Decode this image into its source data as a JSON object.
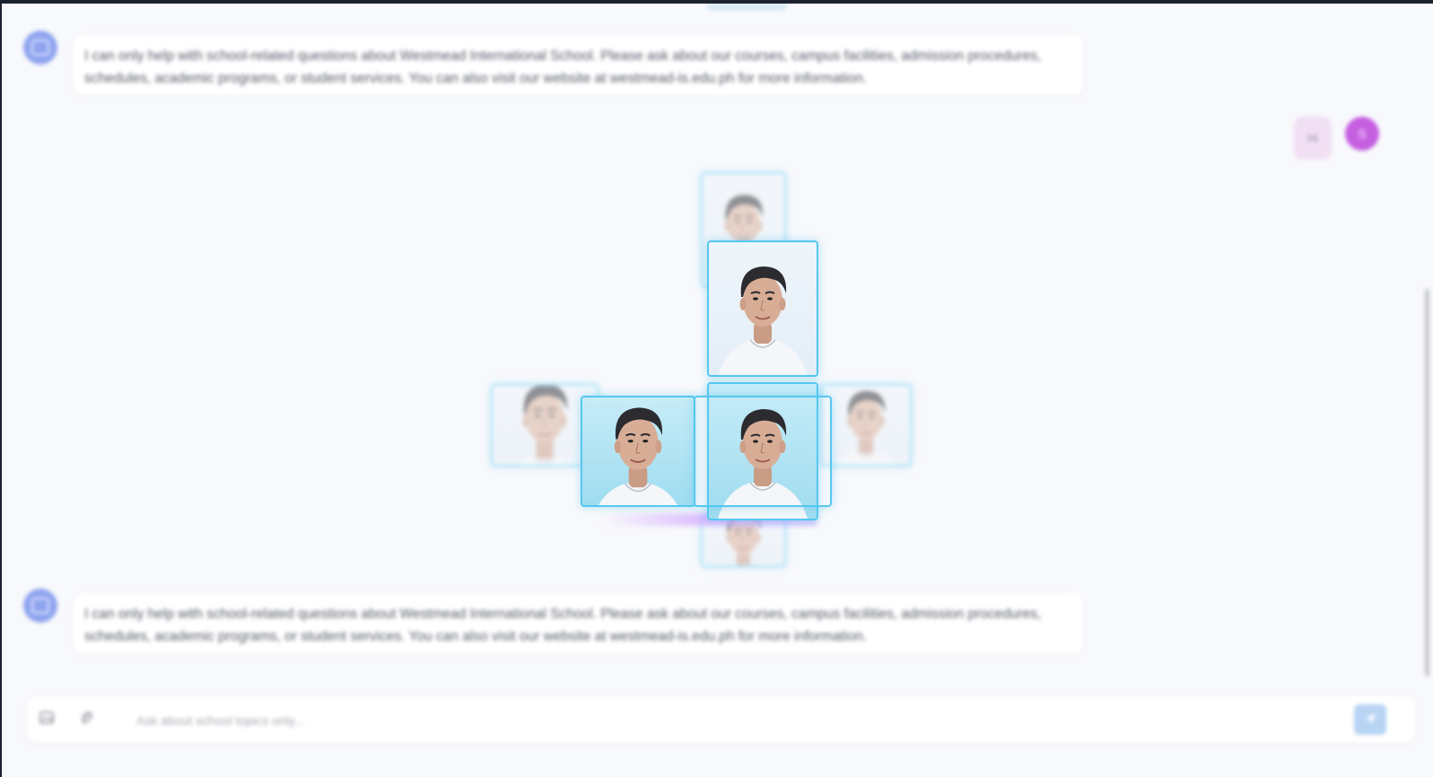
{
  "messages": [
    {
      "role": "assistant",
      "text": "I can only help with school-related questions about Westmead International School. Please ask about our courses, campus facilities, admission procedures, schedules, academic programs, or student services. You can also visit our website at westmead-is.edu.ph for more information."
    },
    {
      "role": "user",
      "text": "Hi",
      "avatar_initial": "S"
    },
    {
      "role": "assistant",
      "text": "I can only help with school-related questions about Westmead International School. Please ask about our courses, campus facilities, admission procedures, schedules, academic programs, or student services. You can also visit our website at westmead-is.edu.ph for more information."
    }
  ],
  "composer": {
    "placeholder": "Ask about school topics only...",
    "value": "",
    "left_icons": [
      "image-icon",
      "paperclip-icon"
    ],
    "send_icon": "send-icon"
  },
  "photo_overlay": {
    "subject": "Photo of a young man smiling, hair combed",
    "accent_color": "#55c8f0"
  },
  "colors": {
    "background": "#f8f9fc",
    "bot_avatar": "#8fa4ef",
    "user_avatar": "#c55fe0",
    "user_bubble": "#f1dff3",
    "send_button": "#b7d4f4"
  }
}
